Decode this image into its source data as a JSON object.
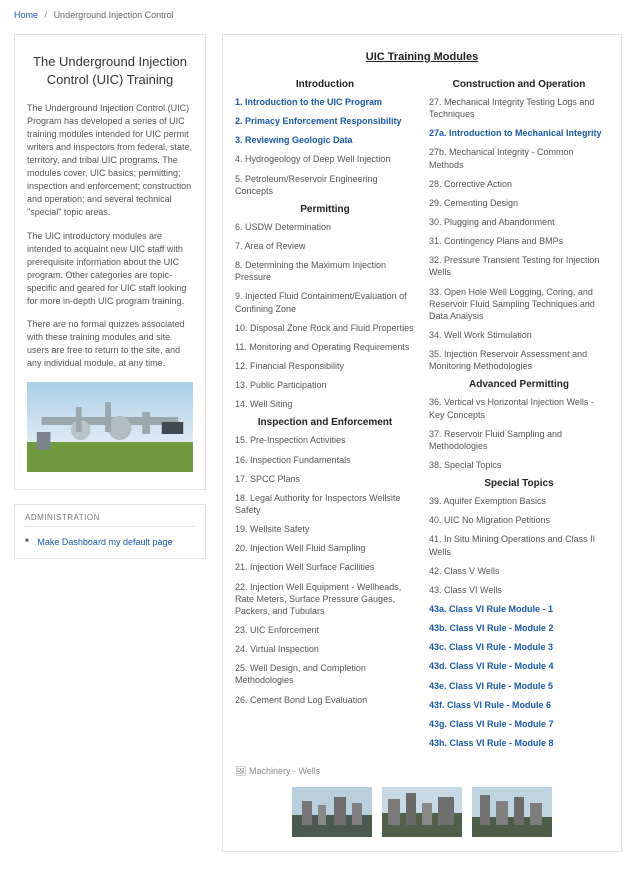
{
  "breadcrumb": {
    "home": "Home",
    "current": "Underground Injection Control"
  },
  "intro": {
    "title": "The Underground Injection Control (UIC) Training",
    "p1": "The Underground Injection Control (UIC) Program has developed a series of UIC training modules intended for UIC permit writers and inspectors from federal, state, territory, and tribal UIC programs. The modules cover, UIC basics; permitting; inspection and enforcement; construction and operation; and several technical \"special\" topic areas.",
    "p2": "The UIC introductory modules are intended to acquaint new UIC staff with prerequisite information about the UIC program. Other categories are topic-specific and geared for UIC staff looking for more in-depth UIC program training.",
    "p3": "There are no formal quizzes associated with these training modules and site users are free to return to the site, and any individual module, at any time."
  },
  "admin": {
    "heading": "ADMINISTRATION",
    "link": "Make Dashboard my default page"
  },
  "modules": {
    "heading": "UIC Training Modules",
    "left_sections": [
      {
        "title": "Introduction",
        "items": [
          {
            "t": "1. Introduction to the UIC Program",
            "hl": true
          },
          {
            "t": "2. Primacy Enforcement Responsibility",
            "hl": true
          },
          {
            "t": "3. Reviewing Geologic Data",
            "hl": true
          },
          {
            "t": "4. Hydrogeology of Deep Well Injection"
          },
          {
            "t": "5. Petroleum/Reservoir Engineering Concepts"
          }
        ]
      },
      {
        "title": "Permitting",
        "items": [
          {
            "t": "6. USDW Determination"
          },
          {
            "t": "7. Area of Review"
          },
          {
            "t": "8. Determining the Maximum Injection Pressure"
          },
          {
            "t": "9. Injected Fluid Containment/Evaluation of Confining Zone"
          },
          {
            "t": "10. Disposal Zone Rock and Fluid Properties"
          },
          {
            "t": "11. Monitoring and Operating Requirements"
          },
          {
            "t": "12. Financial Responsibility"
          },
          {
            "t": "13. Public Participation"
          },
          {
            "t": "14. Well Siting"
          }
        ]
      },
      {
        "title": "Inspection and Enforcement",
        "items": [
          {
            "t": "15. Pre-Inspection Activities"
          },
          {
            "t": "16. Inspection Fundamentals"
          },
          {
            "t": "17. SPCC Plans"
          },
          {
            "t": "18. Legal Authority for Inspectors Wellsite Safety"
          },
          {
            "t": "19. Wellsite Safety"
          },
          {
            "t": "20. Injection Well Fluid Sampling"
          },
          {
            "t": "21. Injection Well Surface Facilities"
          },
          {
            "t": "22. Injection Well Equipment - Wellheads, Rate Meters, Surface Pressure Gauges, Packers, and Tubulars"
          },
          {
            "t": "23. UIC Enforcement"
          },
          {
            "t": "24. Virtual Inspection"
          },
          {
            "t": "25.  Well Design, and Completion Methodologies"
          },
          {
            "t": "26.  Cement Bond Log Evaluation"
          }
        ]
      }
    ],
    "right_sections": [
      {
        "title": "Construction and Operation",
        "items": [
          {
            "t": "27. Mechanical Integrity Testing Logs and Techniques"
          },
          {
            "t": "27a. Introduction to Mechanical Integrity",
            "hl": true
          },
          {
            "t": "27b. Mechanical Integrity - Common Methods"
          },
          {
            "t": "28. Corrective Action"
          },
          {
            "t": "29. Cementing Design"
          },
          {
            "t": "30. Plugging and Abandonment"
          },
          {
            "t": "31. Contingency Plans and BMPs"
          },
          {
            "t": "32. Pressure Transient Testing for Injection Wells"
          },
          {
            "t": "33. Open Hole Well Logging, Coring, and Reservoir Fluid Sampling Techniques and Data Analysis"
          },
          {
            "t": "34. Well Work Stimulation"
          },
          {
            "t": "35. Injection Reservoir Assessment and Monitoring Methodologies"
          }
        ]
      },
      {
        "title": "Advanced Permitting",
        "items": [
          {
            "t": "36. Vertical vs Horizontal Injection Wells - Key Concepts"
          },
          {
            "t": "37. Reservoir Fluid Sampling and Methodologies"
          },
          {
            "t": "38. Special Topics"
          }
        ]
      },
      {
        "title": "Special Topics",
        "items": [
          {
            "t": "39. Aquifer Exemption Basics"
          },
          {
            "t": "40. UIC No Migration Petitions"
          },
          {
            "t": "41. In Situ Mining Operations and Class II Wells"
          },
          {
            "t": "42. Class V Wells"
          },
          {
            "t": "43. Class VI Wells"
          },
          {
            "t": "43a. Class VI Rule Module - 1",
            "hl": true
          },
          {
            "t": "43b. Class VI Rule - Module 2",
            "hl": true
          },
          {
            "t": "43c. Class VI Rule - Module 3",
            "hl": true
          },
          {
            "t": "43d. Class VI Rule - Module 4",
            "hl": true
          },
          {
            "t": "43e. Class VI Rule - Module 5",
            "hl": true
          },
          {
            "t": "43f. Class VI Rule - Module 6",
            "hl": true
          },
          {
            "t": "43g. Class VI Rule - Module 7",
            "hl": true
          },
          {
            "t": "43h. Class VI Rule - Module 8",
            "hl": true
          }
        ]
      }
    ],
    "gallery_label": "Machinery - Wells"
  }
}
